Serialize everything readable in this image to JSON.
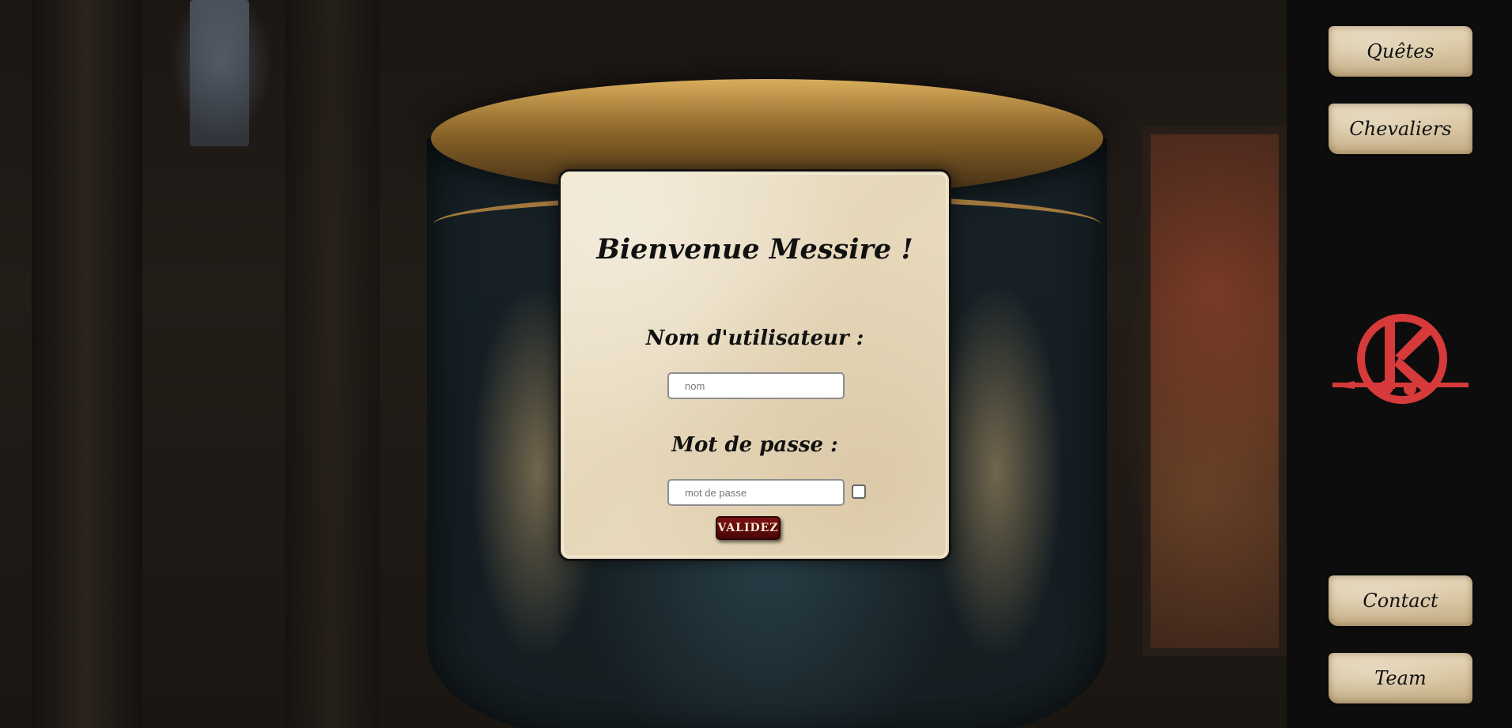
{
  "sidebar": {
    "nav_top": [
      {
        "label": "Quêtes"
      },
      {
        "label": "Chevaliers"
      }
    ],
    "nav_bottom": [
      {
        "label": "Contact"
      },
      {
        "label": "Team"
      }
    ],
    "logo_icon": "k-emblem-logo",
    "logo_color": "#d63a3a"
  },
  "login": {
    "title": "Bienvenue Messire !",
    "username_label": "Nom d'utilisateur :",
    "username_placeholder": "nom",
    "username_value": "",
    "password_label": "Mot de passe :",
    "password_placeholder": "mot de passe",
    "password_value": "",
    "show_password_checked": false,
    "submit_label": "VALIDEZ",
    "submit_color": "#5e0b0b"
  },
  "colors": {
    "parchment": "#e9dcc1",
    "sidebar_bg": "#0d0d0d"
  }
}
